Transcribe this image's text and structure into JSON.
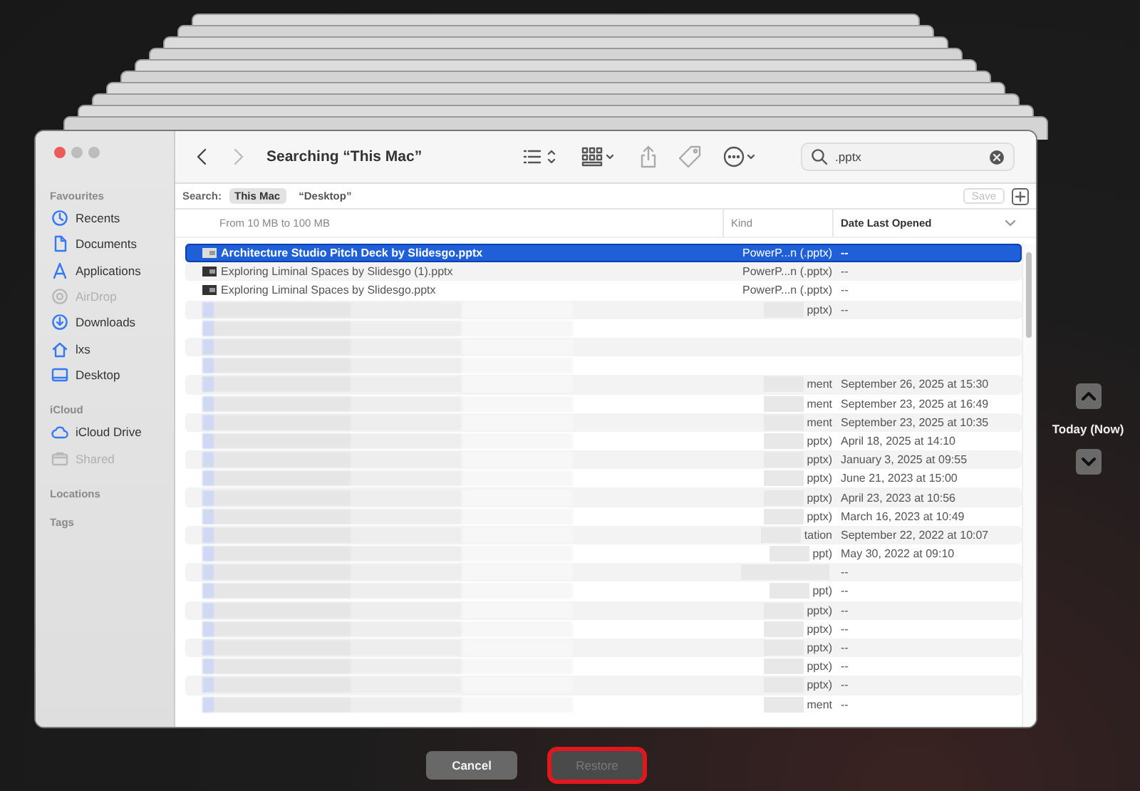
{
  "window": {
    "title": "Searching “This Mac”",
    "back_disabled": false,
    "forward_disabled": true
  },
  "sidebar": {
    "sections": [
      {
        "title": "Favourites",
        "items": [
          {
            "label": "Recents",
            "disabled": false
          },
          {
            "label": "Documents",
            "disabled": false
          },
          {
            "label": "Applications",
            "disabled": false
          },
          {
            "label": "AirDrop",
            "disabled": true
          },
          {
            "label": "Downloads",
            "disabled": false
          },
          {
            "label": "lxs",
            "disabled": false
          },
          {
            "label": "Desktop",
            "disabled": false
          }
        ]
      },
      {
        "title": "iCloud",
        "items": [
          {
            "label": "iCloud Drive",
            "disabled": false
          },
          {
            "label": "Shared",
            "disabled": true
          }
        ]
      },
      {
        "title": "Locations"
      },
      {
        "title": "Tags"
      }
    ]
  },
  "search_field": {
    "value": ".pptx"
  },
  "search_scope": {
    "label": "Search:",
    "scopes": [
      {
        "label": "This Mac",
        "selected": true
      },
      {
        "label": "“Desktop”",
        "selected": false
      }
    ],
    "save": {
      "label": "Save",
      "disabled": true
    }
  },
  "table": {
    "columns": [
      "From 10 MB to 100 MB",
      "Kind",
      "Date Last Opened"
    ],
    "rows": [
      {
        "selected": true,
        "name": "Architecture Studio Pitch Deck by Slidesgo.pptx",
        "kind": "PowerP...n (.pptx)",
        "date": "--"
      },
      {
        "selected": false,
        "name": "Exploring Liminal Spaces by Slidesgo (1).pptx",
        "kind": "PowerP...n (.pptx)",
        "date": "--"
      },
      {
        "selected": false,
        "name": "Exploring Liminal Spaces by Slidesgo.pptx",
        "kind": "PowerP...n (.pptx)",
        "date": "--"
      },
      {
        "selected": false,
        "kind": "pptx)",
        "date": "--"
      },
      {
        "selected": false
      },
      {
        "selected": false
      },
      {
        "selected": false
      },
      {
        "selected": false,
        "kind": "ment",
        "date": "September 26, 2025 at 15:30"
      },
      {
        "selected": false,
        "kind": "ment",
        "date": "September 23, 2025 at 16:49"
      },
      {
        "selected": false,
        "kind": "ment",
        "date": "September 23, 2025 at 10:35"
      },
      {
        "selected": false,
        "kind": "pptx)",
        "date": "April 18, 2025 at 14:10"
      },
      {
        "selected": false,
        "kind": "pptx)",
        "date": "January 3, 2025 at 09:55"
      },
      {
        "selected": false,
        "kind": "pptx)",
        "date": "June 21, 2023 at 15:00"
      },
      {
        "selected": false,
        "kind": "pptx)",
        "date": "April 23, 2023 at 10:56"
      },
      {
        "selected": false,
        "kind": "pptx)",
        "date": "March 16, 2023 at 10:49"
      },
      {
        "selected": false,
        "kind": "tation",
        "date": "September 22, 2022 at 10:07"
      },
      {
        "selected": false,
        "kind": "ppt)",
        "date": "May 30, 2022 at 09:10"
      },
      {
        "selected": false,
        "date": "--"
      },
      {
        "selected": false,
        "kind": "ppt)",
        "date": "--"
      },
      {
        "selected": false,
        "kind": "pptx)",
        "date": "--"
      },
      {
        "selected": false,
        "kind": "pptx)",
        "date": "--"
      },
      {
        "selected": false,
        "kind": "pptx)",
        "date": "--"
      },
      {
        "selected": false,
        "kind": "pptx)",
        "date": "--"
      },
      {
        "selected": false,
        "kind": "pptx)",
        "date": "--"
      },
      {
        "selected": false,
        "kind": "ment",
        "date": "--"
      }
    ]
  },
  "timeline": {
    "label": "Today (Now)"
  },
  "buttons": [
    {
      "label": "Cancel",
      "disabled": false,
      "highlighted": false
    },
    {
      "label": "Restore",
      "disabled": true,
      "highlighted": true
    }
  ]
}
